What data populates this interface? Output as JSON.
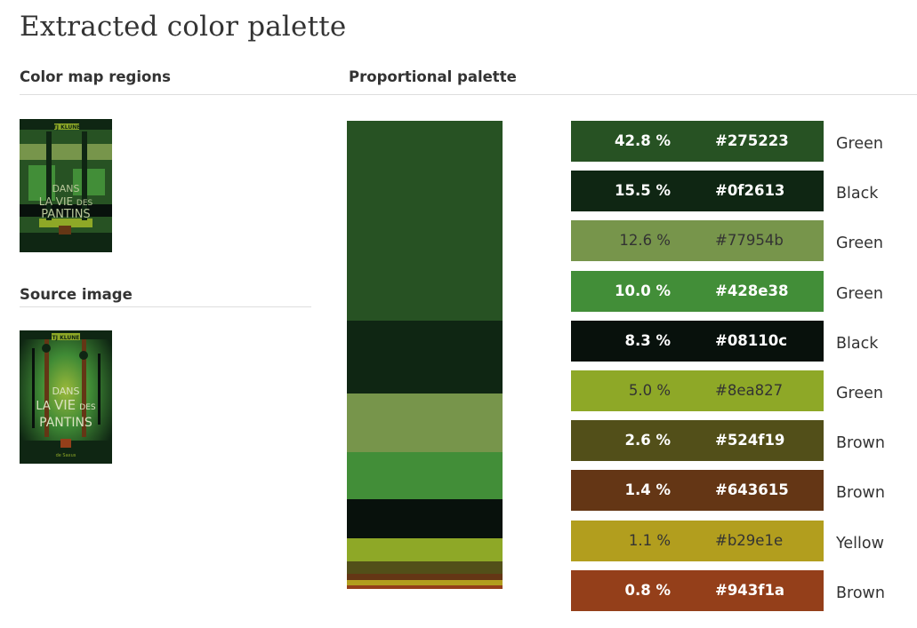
{
  "page": {
    "title": "Extracted color palette"
  },
  "sections": {
    "map_heading": "Color map regions",
    "proportional_heading": "Proportional palette",
    "source_heading": "Source image"
  },
  "cover": {
    "author": "TJ KLUNE",
    "line1": "DANS",
    "line2a": "LA",
    "line2b": "VIE",
    "line2c": "DES",
    "line3": "PANTINS",
    "publisher": "de Saxus"
  },
  "palette": [
    {
      "percent": "42.8 %",
      "share": 42.8,
      "hex": "#275223",
      "color": "#275223",
      "name": "Green",
      "text_color": "#ffffff",
      "light": false
    },
    {
      "percent": "15.5 %",
      "share": 15.5,
      "hex": "#0f2613",
      "color": "#0f2613",
      "name": "Black",
      "text_color": "#ffffff",
      "light": false
    },
    {
      "percent": "12.6 %",
      "share": 12.6,
      "hex": "#77954b",
      "color": "#77954b",
      "name": "Green",
      "text_color": "#333333",
      "light": true
    },
    {
      "percent": "10.0 %",
      "share": 10.0,
      "hex": "#428e38",
      "color": "#428e38",
      "name": "Green",
      "text_color": "#ffffff",
      "light": false
    },
    {
      "percent": "8.3 %",
      "share": 8.3,
      "hex": "#08110c",
      "color": "#08110c",
      "name": "Black",
      "text_color": "#ffffff",
      "light": false
    },
    {
      "percent": "5.0 %",
      "share": 5.0,
      "hex": "#8ea827",
      "color": "#8ea827",
      "name": "Green",
      "text_color": "#333333",
      "light": true
    },
    {
      "percent": "2.6 %",
      "share": 2.6,
      "hex": "#524f19",
      "color": "#524f19",
      "name": "Brown",
      "text_color": "#ffffff",
      "light": false
    },
    {
      "percent": "1.4 %",
      "share": 1.4,
      "hex": "#643615",
      "color": "#643615",
      "name": "Brown",
      "text_color": "#ffffff",
      "light": false
    },
    {
      "percent": "1.1 %",
      "share": 1.1,
      "hex": "#b29e1e",
      "color": "#b29e1e",
      "name": "Yellow",
      "text_color": "#333333",
      "light": true
    },
    {
      "percent": "0.8 %",
      "share": 0.8,
      "hex": "#943f1a",
      "color": "#943f1a",
      "name": "Brown",
      "text_color": "#ffffff",
      "light": false
    }
  ]
}
